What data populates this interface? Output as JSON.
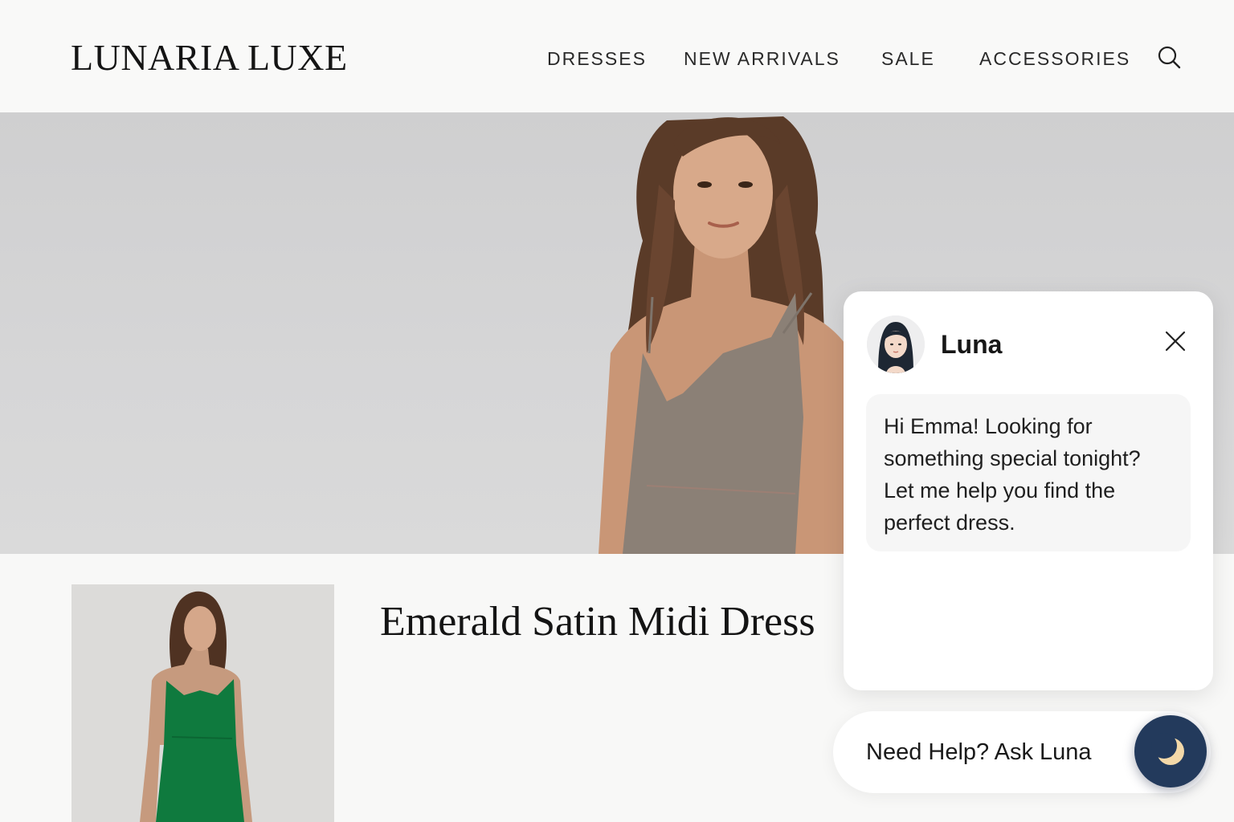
{
  "header": {
    "logo": "LUNARIA LUXE",
    "nav": {
      "dresses": "DRESSES",
      "new_arrivals": "NEW ARRIVALS",
      "sale": "SALE",
      "accessories": "ACCESSORIES"
    },
    "search_icon": "search-icon"
  },
  "hero": {
    "image": "model-in-taupe-slip-dress"
  },
  "product": {
    "title": "Emerald Satin Midi Dress",
    "image": "model-in-emerald-satin-dress",
    "dress_color": "#0f7a3e"
  },
  "chat": {
    "assistant_name": "Luna",
    "message": "Hi Emma! Looking for something special tonight? Let me help you find the perfect dress.",
    "close_icon": "close-icon"
  },
  "launcher": {
    "label": "Need Help? Ask Luna",
    "icon": "moon-icon",
    "color": "#233a5c"
  }
}
